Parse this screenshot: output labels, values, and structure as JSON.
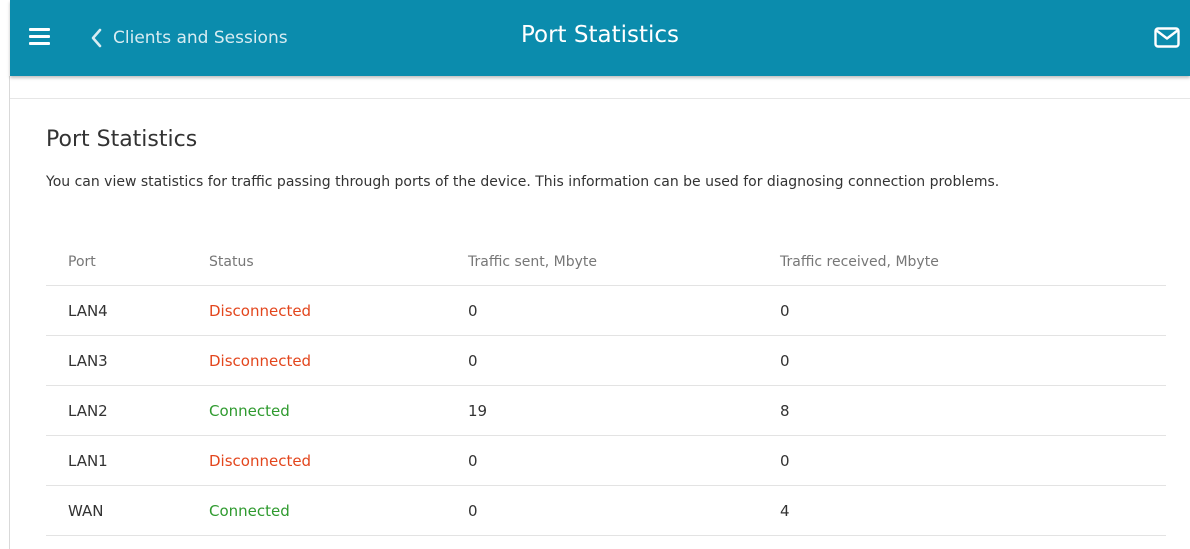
{
  "header": {
    "menu_icon": "hamburger-menu-icon",
    "back_icon": "chevron-left-icon",
    "back_label": "Clients and Sessions",
    "title": "Port Statistics",
    "mail_icon": "envelope-icon",
    "background_color": "#0b8cad"
  },
  "content": {
    "title": "Port Statistics",
    "description": "You can view statistics for traffic passing through ports of the device. This information can be used for diagnosing connection problems."
  },
  "table": {
    "columns": [
      "Port",
      "Status",
      "Traffic sent, Mbyte",
      "Traffic received, Mbyte"
    ],
    "rows": [
      {
        "port": "LAN4",
        "status": "Disconnected",
        "sent": "0",
        "received": "0"
      },
      {
        "port": "LAN3",
        "status": "Disconnected",
        "sent": "0",
        "received": "0"
      },
      {
        "port": "LAN2",
        "status": "Connected",
        "sent": "19",
        "received": "8"
      },
      {
        "port": "LAN1",
        "status": "Disconnected",
        "sent": "0",
        "received": "0"
      },
      {
        "port": "WAN",
        "status": "Connected",
        "sent": "0",
        "received": "4"
      }
    ],
    "status_colors": {
      "Disconnected": "#e3461d",
      "Connected": "#2f9a2f"
    }
  }
}
